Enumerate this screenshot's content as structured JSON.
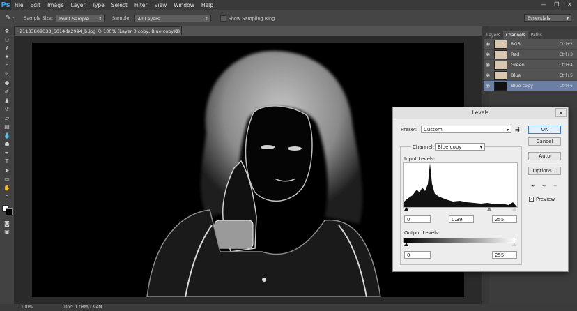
{
  "app": {
    "logo": "Ps"
  },
  "menu": [
    "File",
    "Edit",
    "Image",
    "Layer",
    "Type",
    "Select",
    "Filter",
    "View",
    "Window",
    "Help"
  ],
  "window_controls": {
    "minimize": "—",
    "restore": "❐",
    "close": "✕"
  },
  "options_bar": {
    "sample_size_label": "Sample Size:",
    "sample_size_value": "Point Sample",
    "sample_label": "Sample:",
    "sample_value": "All Layers",
    "show_ring_label": "Show Sampling Ring",
    "workspace": "Essentials"
  },
  "document": {
    "tab_title": "21133809333_6014da2994_b.jpg @ 100% (Layer 0 copy, Blue copy/8) *",
    "close": "×"
  },
  "status": {
    "zoom": "100%",
    "doc": "Doc: 1.08M/1.94M"
  },
  "panel": {
    "tabs": [
      "Layers",
      "Channels",
      "Paths"
    ],
    "active_tab": "Channels",
    "channels": [
      {
        "name": "RGB",
        "shortcut": "Ctrl+2",
        "visible": true,
        "selected": false
      },
      {
        "name": "Red",
        "shortcut": "Ctrl+3",
        "visible": true,
        "selected": false
      },
      {
        "name": "Green",
        "shortcut": "Ctrl+4",
        "visible": true,
        "selected": false
      },
      {
        "name": "Blue",
        "shortcut": "Ctrl+5",
        "visible": true,
        "selected": false
      },
      {
        "name": "Blue copy",
        "shortcut": "Ctrl+6",
        "visible": true,
        "selected": true
      }
    ]
  },
  "levels": {
    "title": "Levels",
    "preset_label": "Preset:",
    "preset_value": "Custom",
    "channel_label": "Channel:",
    "channel_value": "Blue copy",
    "input_levels_label": "Input Levels:",
    "input_black": "0",
    "input_gamma": "0.39",
    "input_white": "255",
    "output_levels_label": "Output Levels:",
    "output_black": "0",
    "output_white": "255",
    "buttons": {
      "ok": "OK",
      "cancel": "Cancel",
      "auto": "Auto",
      "options": "Options..."
    },
    "preview_label": "Preview",
    "preview_checked": true
  }
}
